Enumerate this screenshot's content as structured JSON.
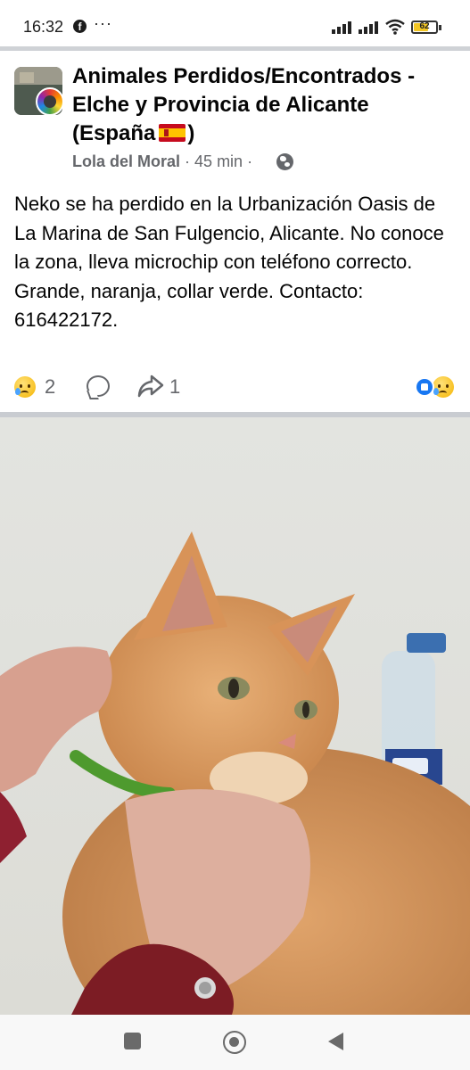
{
  "status_bar": {
    "time": "16:32",
    "more": "···",
    "battery": "62",
    "battery_level": 0.62
  },
  "post": {
    "group_name": "Animales Perdidos/Encontrados - Elche y Provincia de Alicante (España",
    "group_name_end": ")",
    "author": "Lola del Moral",
    "time_ago": "· 45 min ·",
    "text": "Neko se ha perdido en la Urbanización Oasis de La Marina de San Fulgencio, Alicante. No conoce la zona, lleva microchip con teléfono correcto. Grande, naranja, collar verde. Contacto: 616422172.",
    "reactions_count": "2",
    "shares_count": "1",
    "icons": {
      "avatar": "group-avatar-icon",
      "privacy": "globe-icon",
      "reaction": "sad-emoji-icon",
      "comment": "comment-icon",
      "share": "share-icon",
      "summary": [
        "like-icon",
        "sad-emoji-icon"
      ]
    }
  },
  "navigation": {
    "icons": [
      "recent-apps-icon",
      "home-icon",
      "back-icon"
    ]
  },
  "colors": {
    "secondary_text": "#65676b",
    "like_blue": "#1877f2",
    "divider": "#c9ccd1"
  }
}
